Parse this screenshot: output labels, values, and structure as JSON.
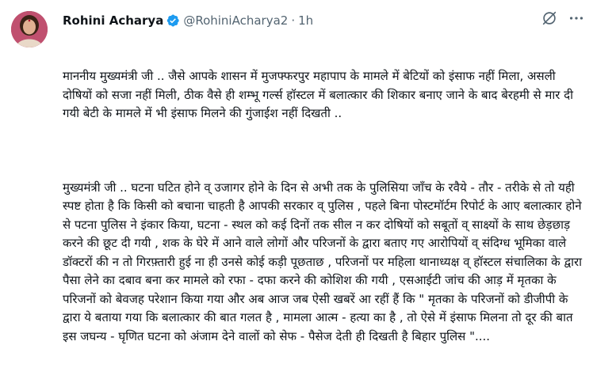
{
  "author": {
    "name": "Rohini Acharya",
    "handle": "@RohiniAcharya2",
    "separator": "·",
    "time": "1h"
  },
  "icons": {
    "verified": "verified-badge-icon",
    "grok": "grok-icon",
    "more": "more-icon"
  },
  "colors": {
    "verified": "#1d9bf0",
    "secondary_text": "#536471",
    "text": "#0f1419"
  },
  "tweet": {
    "paragraphs": [
      "माननीय मुख्यमंत्री जी .. जैसे आपके शासन में मुजफ्फरपुर महापाप के मामले में बेटियों को इंसाफ नहीं मिला, असली दोषियों को सजा नहीं मिली, ठीक वैसे ही शम्भू गर्ल्स हॉस्टल में बलात्कार की शिकार बनाए जाने के बाद बेरहमी से मार दी गयी बेटी के मामले में भी इंसाफ मिलने की गुंजाईश नहीं दिखती ..",
      "मुख्यमंत्री जी .. घटना घटित होने व् उजागर होने के दिन से अभी तक के पुलिसिया जाँच के रवैये - तौर - तरीके से तो यही स्पष्ट होता है कि किसी को बचाना चाहती है आपकी सरकार व् पुलिस , पहले बिना पोस्टमॉर्टम रिपोर्ट के आए बलात्कार होने से पटना पुलिस ने इंकार किया, घटना - स्थल को कई दिनों तक सील न कर दोषियों को सबूतों व् साक्ष्यों के साथ छेड़छाड़ करने की छूट दी गयी , शक के घेरे में आने वाले लोगों और परिजनों के द्वारा बताए गए आरोपियों व् संदिग्ध भूमिका वाले डॉक्टरों की न तो गिरफ़्तारी हुई ना ही उनसे कोई कड़ी पूछताछ , परिजनों पर महिला थानाध्यक्ष व् हॉस्टल संचालिका के द्वारा पैसा लेने का दबाव बना कर मामले को रफा - दफा करने की कोशिश की गयी , एसआईटी जांच की आड़ में मृतका के परिजनों को बेवजह परेशान किया गया और अब आज जब ऐसी खबरें आ रहीं हैं कि \" मृतका के परिजनों को डीजीपी के द्वारा ये बताया गया कि बलात्कार की बात गलत है , मामला आत्म - हत्या का है , तो ऐसे में इंसाफ मिलना तो दूर की बात इस जघन्य - घृणित घटना को अंजाम देने वालों को सेफ - पैसेज देती ही दिखती है बिहार पुलिस \"...."
    ]
  }
}
